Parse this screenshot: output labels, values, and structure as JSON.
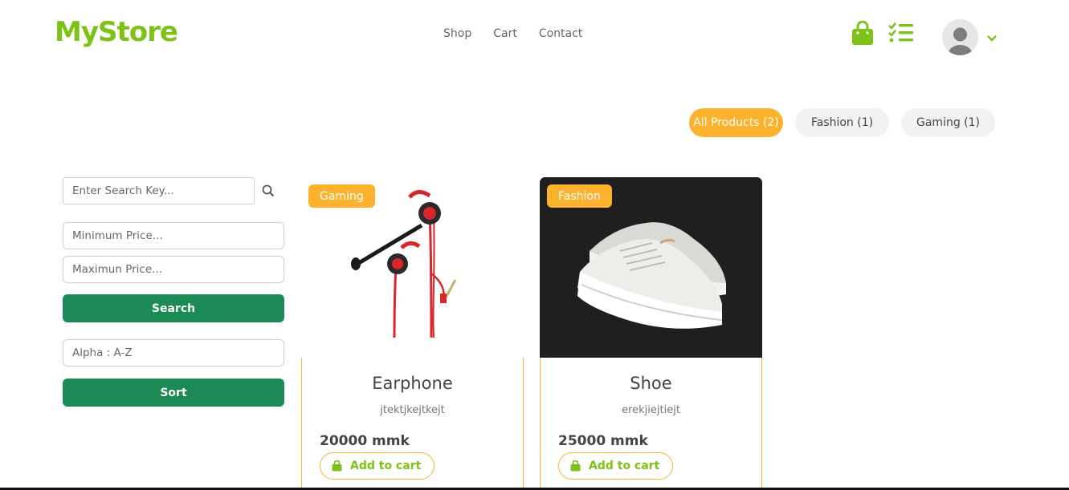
{
  "header": {
    "logo": "MyStore",
    "nav": [
      "Shop",
      "Cart",
      "Contact"
    ]
  },
  "filters": {
    "pills": [
      "All Products (2)",
      "Fashion (1)",
      "Gaming (1)"
    ],
    "active": "All Products (2)"
  },
  "sidebar": {
    "search_placeholder": "Enter Search Key...",
    "min_price_placeholder": "Minimum Price...",
    "max_price_placeholder": "Maximun Price...",
    "search_button": "Search",
    "sort_value": "Alpha : A-Z",
    "sort_button": "Sort"
  },
  "products": [
    {
      "tag": "Gaming",
      "name": "Earphone",
      "description": "jtektjkejtkejt",
      "price": "20000 mmk",
      "cart_label": "Add to cart"
    },
    {
      "tag": "Fashion",
      "name": "Shoe",
      "description": "erekjiejtiejt",
      "price": "25000 mmk",
      "cart_label": "Add to cart"
    }
  ],
  "colors": {
    "brand_green": "#7cc217",
    "accent_orange": "#fcb22c",
    "button_green": "#1b8a55"
  },
  "icons": [
    "shopping-bag-icon",
    "checklist-icon",
    "user-avatar-icon",
    "chevron-down-icon",
    "search-icon"
  ]
}
